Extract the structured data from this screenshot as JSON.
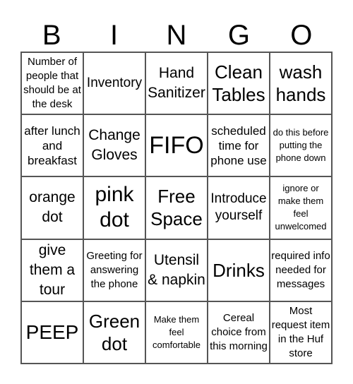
{
  "header": [
    "B",
    "I",
    "N",
    "G",
    "O"
  ],
  "board": [
    [
      "Number of people that should be at the desk",
      "Inventory",
      "Hand Sanitizer",
      "Clean Tables",
      "wash hands"
    ],
    [
      "after lunch and breakfast",
      "Change Gloves",
      "FIFO",
      "scheduled time for phone use",
      "do this before putting the phone down"
    ],
    [
      "orange dot",
      "pink dot",
      "Free Space",
      "Introduce yourself",
      "ignore or make them feel unwelcomed"
    ],
    [
      "give them a tour",
      "Greeting for answering the phone",
      "Utensil & napkin",
      "Drinks",
      "required info needed for messages"
    ],
    [
      "PEEP",
      "Green dot",
      "Make them feel comfortable",
      "Cereal choice from this morning",
      "Most request item in the Huf store"
    ]
  ]
}
